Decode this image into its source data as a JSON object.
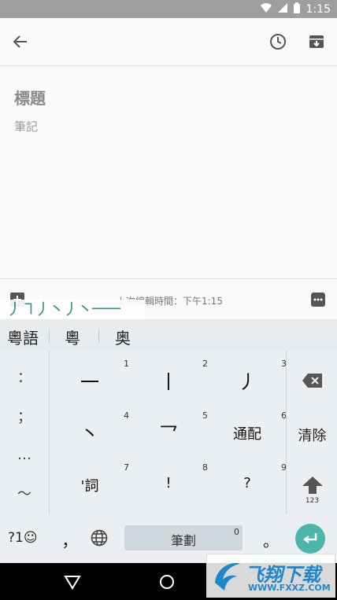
{
  "status_bar": {
    "time": "1:15"
  },
  "note": {
    "title_placeholder": "標題",
    "body_placeholder": "筆記"
  },
  "bottom_bar": {
    "edited_text": "上次編輯時間：下午1:15"
  },
  "stroke_hint": "丿㇕丿丶丿丶一一",
  "candidates": [
    "粵語",
    "粵",
    "奥"
  ],
  "keyboard": {
    "left_column": [
      "：",
      "；",
      "…",
      "～"
    ],
    "keys": [
      {
        "num": "1",
        "label": "一"
      },
      {
        "num": "2",
        "label": "丨"
      },
      {
        "num": "3",
        "label": "丿"
      },
      {
        "num": "4",
        "label": "丶"
      },
      {
        "num": "5",
        "label": "乛"
      },
      {
        "num": "6",
        "label": "通配"
      },
      {
        "num": "7",
        "label": "'詞"
      },
      {
        "num": "8",
        "label": "!"
      },
      {
        "num": "9",
        "label": "?"
      }
    ],
    "clear_label": "清除",
    "shift_sub": "123",
    "symbols_label": "?1☺",
    "comma": "，",
    "space_label": "筆劃",
    "space_num": "0",
    "period": "。"
  },
  "watermark": {
    "text": "飞翔下载",
    "url": "WWW.FXXZ.COM"
  },
  "colors": {
    "accent": "#4db6ac",
    "status_bar": "#9e9e9e"
  }
}
